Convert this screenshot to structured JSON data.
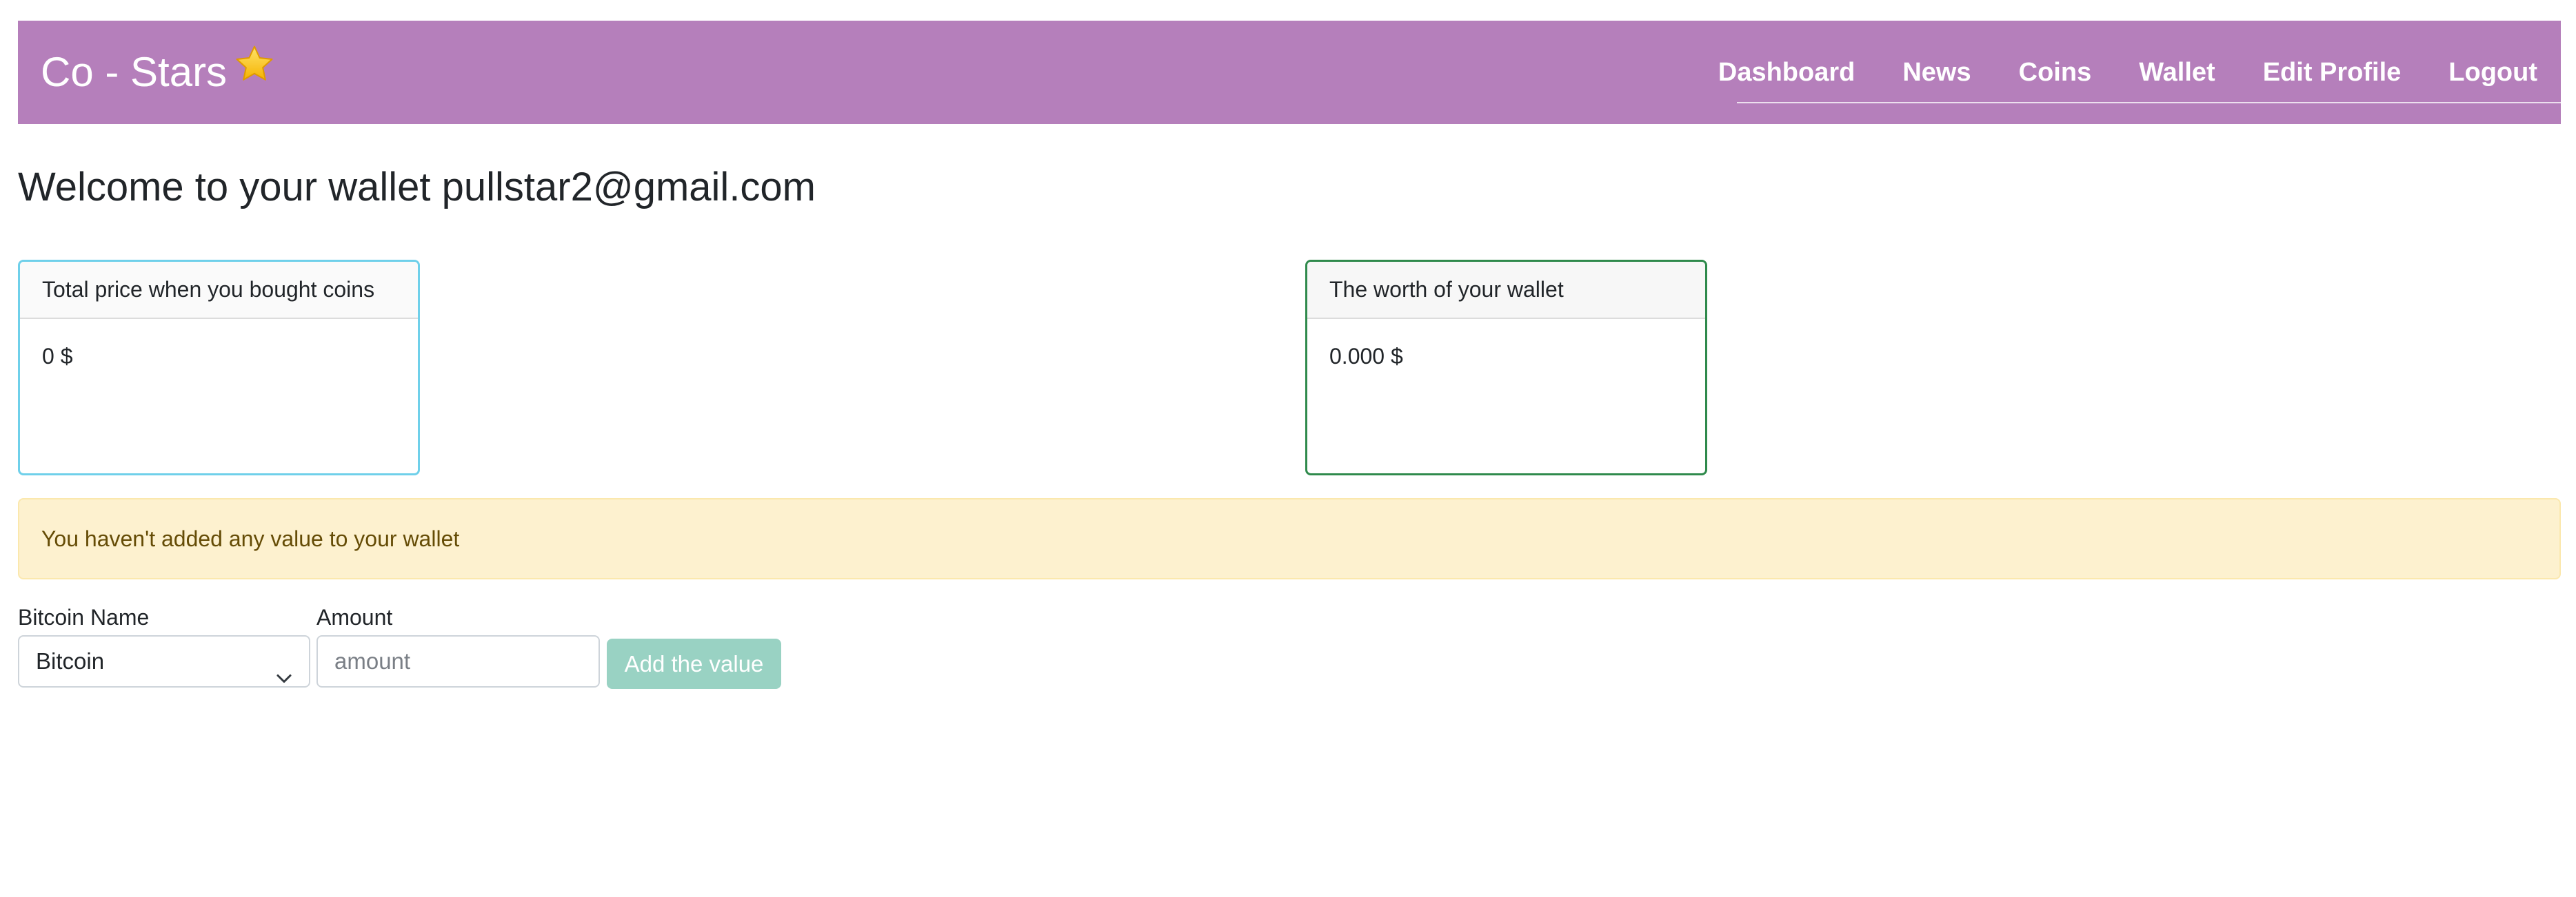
{
  "navbar": {
    "brand": "Co - Stars",
    "brand_icon": "star-icon",
    "links": [
      "Dashboard",
      "News",
      "Coins",
      "Wallet",
      "Edit Profile",
      "Logout"
    ],
    "background": "#b57fbb"
  },
  "page": {
    "welcome": "Welcome to your wallet pullstar2@gmail.com"
  },
  "cards": {
    "total_price": {
      "header": "Total price when you bought coins",
      "value": "0 $",
      "border_color": "#6fd0ea"
    },
    "wallet_worth": {
      "header": "The worth of your wallet",
      "value": "0.000 $",
      "border_color": "#2f8a4c"
    }
  },
  "alert": {
    "text": "You haven't added any value to your wallet",
    "background": "#fdf1cf"
  },
  "form": {
    "coin_label": "Bitcoin Name",
    "coin_selected": "Bitcoin",
    "amount_label": "Amount",
    "amount_placeholder": "amount",
    "amount_value": "",
    "submit_label": "Add the value",
    "submit_color": "#99d2c3"
  }
}
